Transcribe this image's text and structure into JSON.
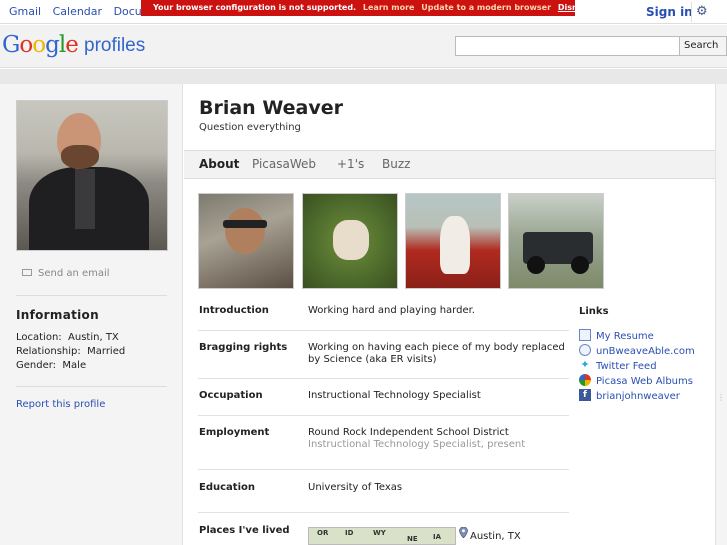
{
  "topbar": {
    "nav": [
      "Gmail",
      "Calendar",
      "Documents"
    ],
    "warning": {
      "text": "Your browser configuration is not supported.",
      "learn_more": "Learn more",
      "update": "Update to a modern browser",
      "dismiss": "Dismiss"
    },
    "sign_in": "Sign in",
    "gear_icon": "gear-icon"
  },
  "header": {
    "logo_letters": [
      "G",
      "o",
      "o",
      "g",
      "l",
      "e"
    ],
    "product": "profiles",
    "search_placeholder": "",
    "search_button": "Search"
  },
  "sidebar": {
    "send_email": "Send an email",
    "information_title": "Information",
    "info": [
      {
        "label": "Location:",
        "value": "Austin, TX"
      },
      {
        "label": "Relationship:",
        "value": "Married"
      },
      {
        "label": "Gender:",
        "value": "Male"
      }
    ],
    "report": "Report this profile"
  },
  "profile": {
    "name": "Brian Weaver",
    "tagline": "Question everything"
  },
  "tabs": [
    "About",
    "PicasaWeb",
    "+1's",
    "Buzz"
  ],
  "about": {
    "introduction": {
      "label": "Introduction",
      "value": "Working hard and playing harder."
    },
    "bragging": {
      "label": "Bragging rights",
      "value": "Working on having each piece of my body replaced by Science (aka ER visits)"
    },
    "occupation": {
      "label": "Occupation",
      "value": "Instructional Technology Specialist"
    },
    "employment": {
      "label": "Employment",
      "value": "Round Rock Independent School District",
      "sub": "Instructional Technology Specialist, present"
    },
    "education": {
      "label": "Education",
      "value": "University of Texas"
    },
    "places": {
      "label": "Places I've lived",
      "value": "Austin, TX",
      "map_labels": [
        "OR",
        "ID",
        "WY",
        "NE",
        "IA"
      ]
    }
  },
  "links": {
    "title": "Links",
    "items": [
      {
        "label": "My Resume",
        "icon": "document-icon"
      },
      {
        "label": "unBweaveAble.com",
        "icon": "globe-icon"
      },
      {
        "label": "Twitter Feed",
        "icon": "twitter-icon"
      },
      {
        "label": "Picasa Web Albums",
        "icon": "picasa-icon"
      },
      {
        "label": "brianjohnweaver",
        "icon": "facebook-icon"
      }
    ]
  },
  "colors": {
    "link": "#2a4fb2",
    "warning_bg": "#cc1111",
    "sidebar_bg": "#f4f4f4"
  }
}
